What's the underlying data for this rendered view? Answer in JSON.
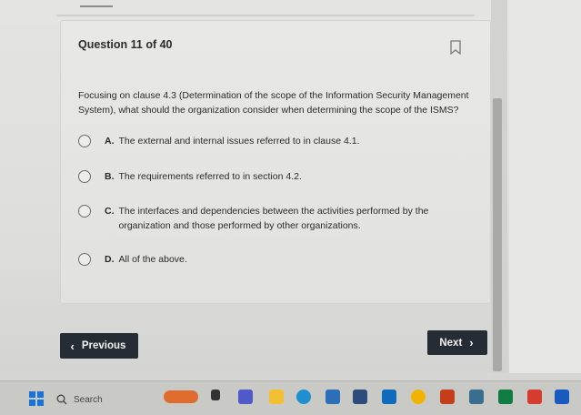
{
  "quiz": {
    "question_header": "Question 11 of 40",
    "question_text": "Focusing on clause 4.3 (Determination of the scope of the Information Security Management System), what should the organization consider when determining the scope of the ISMS?",
    "options": [
      {
        "letter": "A.",
        "text": "The external and internal issues referred to in clause 4.1."
      },
      {
        "letter": "B.",
        "text": "The requirements referred to in section 4.2."
      },
      {
        "letter": "C.",
        "text": "The interfaces and dependencies between the activities performed by the organization and those performed by other organizations."
      },
      {
        "letter": "D.",
        "text": "All of the above."
      }
    ],
    "bookmark_icon": "bookmark-icon"
  },
  "navigation": {
    "previous_label": "Previous",
    "next_label": "Next",
    "prev_icon": "chevron-left-icon",
    "next_icon": "chevron-right-icon"
  },
  "taskbar": {
    "search_placeholder": "Search",
    "icons": [
      "windows-start-icon",
      "search-icon",
      "widget-icon",
      "task-view-icon",
      "teams-icon",
      "file-explorer-icon",
      "edge-icon",
      "store-icon",
      "app-icon",
      "outlook-icon",
      "chrome-icon",
      "powerpoint-icon",
      "app-icon",
      "excel-icon",
      "acrobat-icon",
      "word-icon"
    ]
  },
  "colors": {
    "button_bg": "#262c33",
    "button_text": "#f2f2f2",
    "page_bg": "#e2e2e0"
  }
}
